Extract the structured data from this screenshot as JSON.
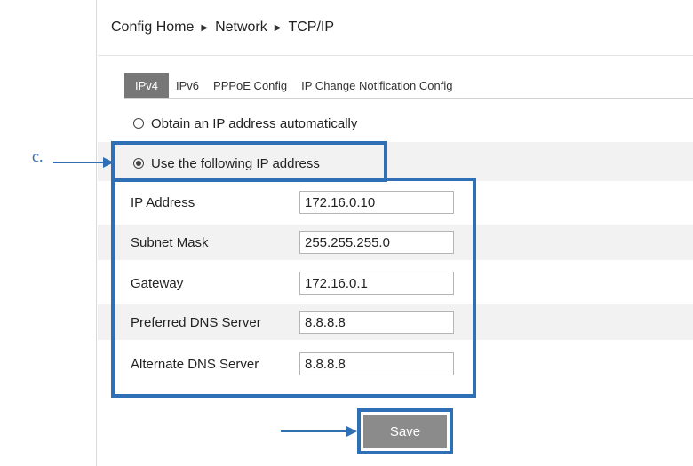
{
  "breadcrumb": {
    "items": [
      "Config Home",
      "Network",
      "TCP/IP"
    ],
    "separator": "▶"
  },
  "tabs": [
    {
      "label": "IPv4",
      "active": true
    },
    {
      "label": "IPv6",
      "active": false
    },
    {
      "label": "PPPoE Config",
      "active": false
    },
    {
      "label": "IP Change Notification Config",
      "active": false
    }
  ],
  "ip_mode": {
    "auto_label": "Obtain an IP address automatically",
    "manual_label": "Use the following IP address",
    "selected": "manual"
  },
  "fields": [
    {
      "label": "IP Address",
      "value": "172.16.0.10"
    },
    {
      "label": "Subnet Mask",
      "value": "255.255.255.0"
    },
    {
      "label": "Gateway",
      "value": "172.16.0.1"
    },
    {
      "label": "Preferred DNS Server",
      "value": "8.8.8.8"
    },
    {
      "label": "Alternate DNS Server",
      "value": "8.8.8.8"
    }
  ],
  "save_label": "Save",
  "annotation": {
    "label": "c."
  },
  "colors": {
    "highlight": "#2e6fb6",
    "active_tab": "#777777",
    "save_button": "#8b8b8b",
    "band": "#f2f2f2"
  }
}
